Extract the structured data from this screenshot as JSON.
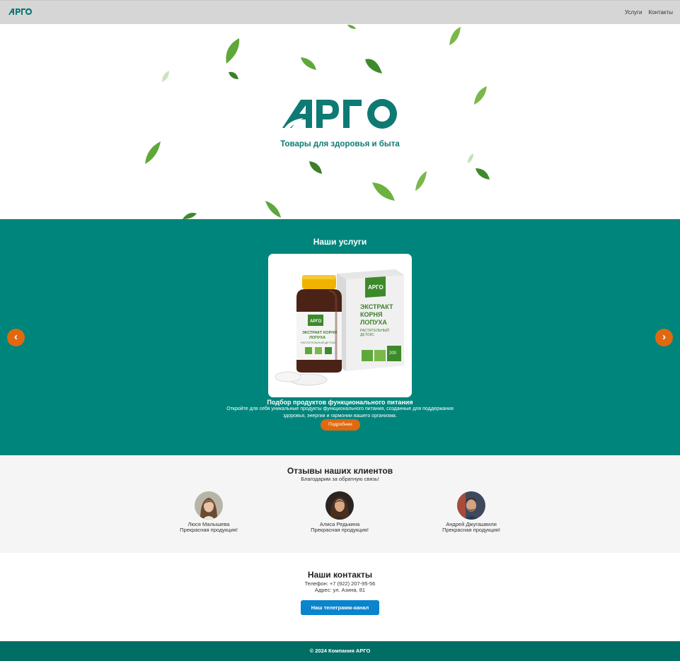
{
  "nav": {
    "logo_text": "АРГО",
    "items": [
      {
        "label": "Услуги"
      },
      {
        "label": "Контакты"
      }
    ]
  },
  "hero": {
    "logo_text": "АРГО",
    "tagline": "Товары для здоровья и быта"
  },
  "services": {
    "title": "Наши услуги",
    "current": {
      "product_label": "ЭКСТРАКТ КОРНЯ ЛОПУХА",
      "product_sub": "РАСТИТЕЛЬНЫЙ ДЕТОКС",
      "title": "Подбор продуктов функционального питания",
      "description": "Откройте для себя уникальные продукты функционального питания, созданные для поддержания здоровья, энергии и гармонии вашего организма.",
      "button_label": "Подробнее"
    },
    "prev_label": "‹",
    "next_label": "›"
  },
  "reviews": {
    "title": "Отзывы наших клиентов",
    "subtitle": "Благодарим за обратную связь!",
    "items": [
      {
        "name": "Люся Малышева",
        "text": "Прекрасная продукция!"
      },
      {
        "name": "Алиса Редькина",
        "text": "Прекрасная продукция!"
      },
      {
        "name": "Андрей Джугашвили",
        "text": "Прекрасная продукция!"
      }
    ]
  },
  "contacts": {
    "title": "Наши контакты",
    "phone": "Телефон: +7 (922) 207-95-56",
    "address": "Адрес: ул. Азина, 81",
    "telegram_label": "Наш телеграмм-канал"
  },
  "footer": {
    "text": "© 2024 Компания АРГО"
  },
  "colors": {
    "brand_teal": "#00857c",
    "accent_orange": "#e0690f",
    "telegram_blue": "#0a84cc",
    "footer_teal": "#006e64"
  }
}
